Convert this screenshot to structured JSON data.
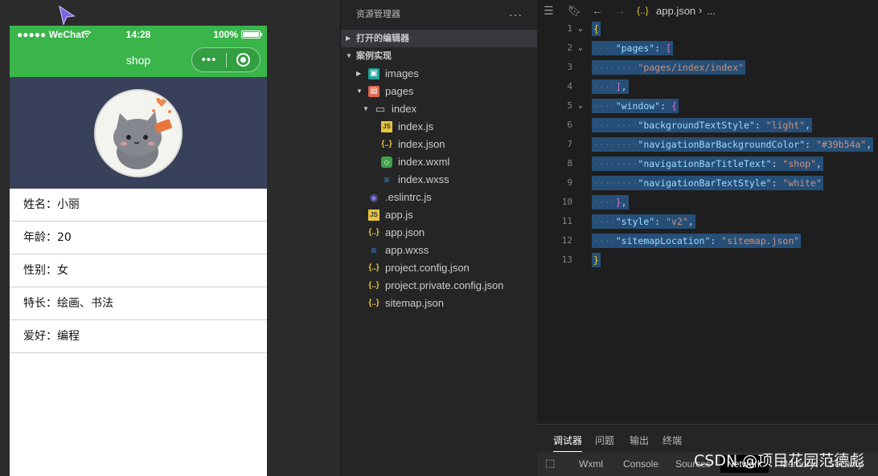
{
  "simulator": {
    "status": {
      "carrier": "●●●●● WeChat",
      "time": "14:28",
      "battery": "100%"
    },
    "navbar": {
      "title": "shop",
      "menu_dots": "•••"
    },
    "info": [
      {
        "text": "姓名：小丽"
      },
      {
        "text": "年龄：20"
      },
      {
        "text": "性别：女"
      },
      {
        "text": "特长：绘画、书法"
      },
      {
        "text": "爱好：编程"
      }
    ]
  },
  "explorer": {
    "title": "资源管理器",
    "more": "···",
    "section_open_editors": "打开的编辑器",
    "section_project": "案例实现",
    "items": [
      {
        "label": "images"
      },
      {
        "label": "pages"
      },
      {
        "label": "index"
      },
      {
        "label": "index.js"
      },
      {
        "label": "index.json"
      },
      {
        "label": "index.wxml"
      },
      {
        "label": "index.wxss"
      },
      {
        "label": ".eslintrc.js"
      },
      {
        "label": "app.js"
      },
      {
        "label": "app.json"
      },
      {
        "label": "app.wxss"
      },
      {
        "label": "project.config.json"
      },
      {
        "label": "project.private.config.json"
      },
      {
        "label": "sitemap.json"
      }
    ]
  },
  "editor": {
    "breadcrumb_file": "app.json",
    "breadcrumb_more": "...",
    "code": {
      "pages_key": "\"pages\"",
      "pages_val": "\"pages/index/index\"",
      "window_key": "\"window\"",
      "bts_key": "\"backgroundTextStyle\"",
      "bts_val": "\"light\"",
      "nbbc_key": "\"navigationBarBackgroundColor\"",
      "nbbc_val": "\"#39b54a\"",
      "nbtt_key": "\"navigationBarTitleText\"",
      "nbtt_val": "\"shop\"",
      "nbts_key": "\"navigationBarTextStyle\"",
      "nbts_val": "\"white\"",
      "style_key": "\"style\"",
      "style_val": "\"v2\"",
      "sitemap_key": "\"sitemapLocation\"",
      "sitemap_val": "\"sitemap.json\""
    }
  },
  "panel": {
    "tabs": [
      "调试器",
      "问题",
      "输出",
      "终端"
    ],
    "devtools": [
      "Wxml",
      "Console",
      "Sources",
      "Network",
      "Memory",
      "Security"
    ]
  },
  "watermark": "CSDN @项目花园范德彪",
  "colors": {
    "navbar": "#39b54a",
    "header": "#39405a",
    "editor_bg": "#1e1e1e",
    "selection": "#264f78"
  }
}
